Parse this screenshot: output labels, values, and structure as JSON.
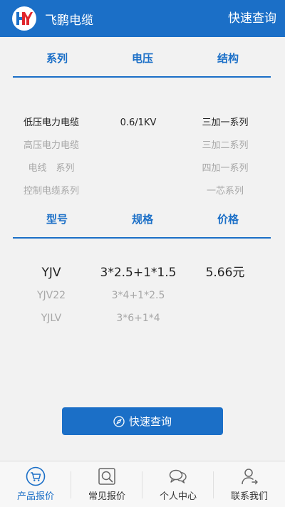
{
  "header": {
    "app_title": "飞鹏电缆",
    "quick_link": "快速查询",
    "brand_color": "#1b6fc7"
  },
  "selector": {
    "columns": [
      "系列",
      "电压",
      "结构"
    ],
    "rows": [
      {
        "series": "低压电力电缆",
        "voltage": "0.6/1KV",
        "structure": "三加一系列",
        "active": true
      },
      {
        "series": "高压电力电缆",
        "voltage": "",
        "structure": "三加二系列",
        "active": false
      },
      {
        "series": "电线　系列",
        "voltage": "",
        "structure": "四加一系列",
        "active": false
      },
      {
        "series": "控制电缆系列",
        "voltage": "",
        "structure": "一芯系列",
        "active": false
      }
    ]
  },
  "product": {
    "columns": [
      "型号",
      "规格",
      "价格"
    ],
    "rows": [
      {
        "model": "YJV",
        "spec": "3*2.5+1*1.5",
        "price": "5.66元",
        "active": true
      },
      {
        "model": "YJV22",
        "spec": "3*4+1*2.5",
        "price": "",
        "active": false
      },
      {
        "model": "YJLV",
        "spec": "3*6+1*4",
        "price": "",
        "active": false
      }
    ]
  },
  "query_button": {
    "label": "快速查询",
    "icon": "compass-icon"
  },
  "bottom_nav": {
    "items": [
      {
        "label": "产品报价",
        "icon": "cart-icon",
        "current": true
      },
      {
        "label": "常见报价",
        "icon": "magnifier-icon",
        "current": false
      },
      {
        "label": "个人中心",
        "icon": "chat-bubbles-icon",
        "current": false
      },
      {
        "label": "联系我们",
        "icon": "person-icon",
        "current": false
      }
    ]
  }
}
